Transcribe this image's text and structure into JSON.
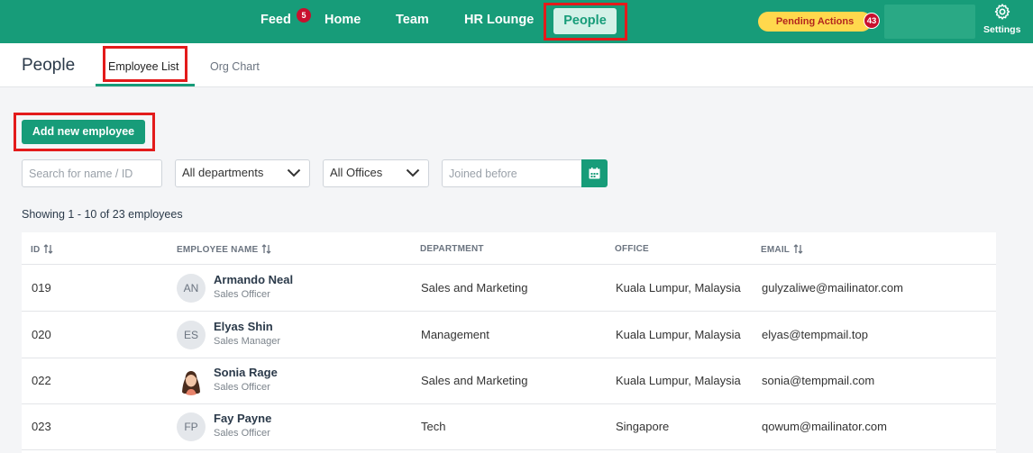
{
  "nav": {
    "items": [
      {
        "label": "Feed"
      },
      {
        "label": "Home"
      },
      {
        "label": "Team"
      },
      {
        "label": "HR Lounge"
      },
      {
        "label": "People"
      }
    ],
    "feed_badge": "5",
    "pending_label": "Pending Actions",
    "pending_badge": "43",
    "settings_label": "Settings"
  },
  "subheader": {
    "title": "People",
    "tabs": [
      {
        "label": "Employee List",
        "active": true
      },
      {
        "label": "Org Chart",
        "active": false
      }
    ]
  },
  "actions": {
    "add_label": "Add new employee"
  },
  "filters": {
    "search_placeholder": "Search for name / ID",
    "department_selected": "All departments",
    "office_selected": "All Offices",
    "joined_placeholder": "Joined before"
  },
  "summary": "Showing 1 - 10 of 23 employees",
  "table": {
    "columns": [
      "ID",
      "EMPLOYEE NAME",
      "DEPARTMENT",
      "OFFICE",
      "EMAIL"
    ],
    "rows": [
      {
        "id": "019",
        "initials": "AN",
        "name": "Armando Neal",
        "role": "Sales Officer",
        "department": "Sales and Marketing",
        "office": "Kuala Lumpur, Malaysia",
        "email": "gulyzaliwe@mailinator.com"
      },
      {
        "id": "020",
        "initials": "ES",
        "name": "Elyas Shin",
        "role": "Sales Manager",
        "department": "Management",
        "office": "Kuala Lumpur, Malaysia",
        "email": "elyas@tempmail.top"
      },
      {
        "id": "022",
        "initials": "",
        "name": "Sonia Rage",
        "role": "Sales Officer",
        "department": "Sales and Marketing",
        "office": "Kuala Lumpur, Malaysia",
        "email": "sonia@tempmail.com"
      },
      {
        "id": "023",
        "initials": "FP",
        "name": "Fay Payne",
        "role": "Sales Officer",
        "department": "Tech",
        "office": "Singapore",
        "email": "qowum@mailinator.com"
      }
    ]
  },
  "colors": {
    "brand": "#179c79",
    "highlight": "#e31b1b",
    "badge": "#c8102e",
    "pending": "#ffd84d"
  }
}
